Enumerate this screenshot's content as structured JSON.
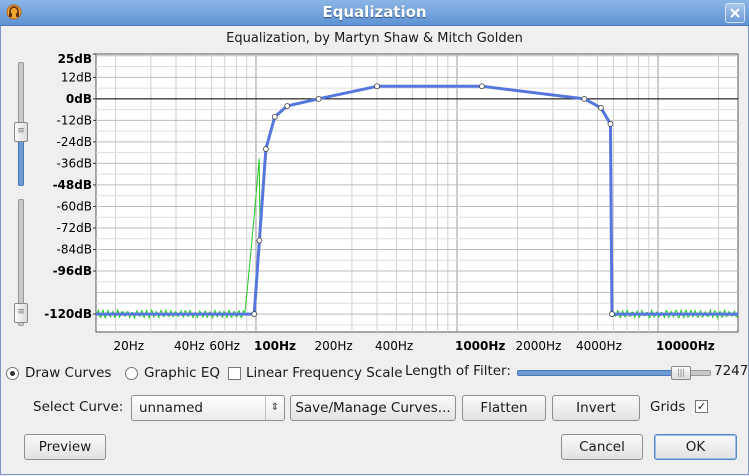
{
  "window": {
    "title": "Equalization"
  },
  "graph": {
    "title": "Equalization, by Martyn Shaw & Mitch Golden",
    "db_labels": [
      "25dB",
      "12dB",
      "0dB",
      "-12dB",
      "-24dB",
      "-36dB",
      "-48dB",
      "-60dB",
      "-72dB",
      "-84dB",
      "-96dB",
      "-120dB"
    ],
    "db_bold": [
      "25dB",
      "0dB",
      "-48dB",
      "-96dB",
      "-120dB"
    ],
    "freq_labels": [
      {
        "text": "20Hz",
        "bold": false
      },
      {
        "text": "40Hz",
        "bold": false
      },
      {
        "text": "60Hz",
        "bold": false
      },
      {
        "text": "100Hz",
        "bold": true
      },
      {
        "text": "200Hz",
        "bold": false
      },
      {
        "text": "400Hz",
        "bold": false
      },
      {
        "text": "1000Hz",
        "bold": true
      },
      {
        "text": "2000Hz",
        "bold": false
      },
      {
        "text": "4000Hz",
        "bold": false
      },
      {
        "text": "10000Hz",
        "bold": true
      }
    ],
    "curve_color": "#5577dd",
    "response_color": "#22cc22"
  },
  "chart_data": {
    "type": "line",
    "title": "Equalization, by Martyn Shaw & Mitch Golden",
    "xscale": "log",
    "ylim": [
      -120,
      25
    ],
    "series": [
      {
        "x": [
          16,
          98,
          104,
          112,
          124,
          143,
          205,
          400,
          1330,
          4300,
          5200,
          5800,
          5900,
          25000
        ],
        "y": [
          -120,
          -120,
          -79,
          -28,
          -10,
          -4,
          0,
          7,
          7,
          0,
          -5,
          -14,
          -120,
          -120
        ]
      }
    ]
  },
  "controls": {
    "draw_curves": "Draw Curves",
    "graphic_eq": "Graphic EQ",
    "linear_freq": "Linear Frequency Scale",
    "length_label": "Length of Filter:",
    "length_value": "7247",
    "length_fraction": 0.85,
    "select_curve_label": "Select Curve:",
    "select_curve_value": "unnamed",
    "save_manage": "Save/Manage Curves...",
    "flatten": "Flatten",
    "invert": "Invert",
    "grids": "Grids",
    "preview": "Preview",
    "cancel": "Cancel",
    "ok": "OK"
  }
}
